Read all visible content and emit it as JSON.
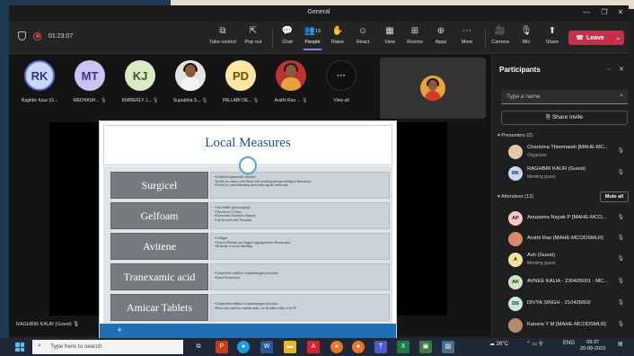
{
  "window": {
    "title": "General"
  },
  "toolbar": {
    "timer": "01:23:07",
    "buttons": [
      {
        "label": "Take control",
        "icon": "⧉"
      },
      {
        "label": "Pop out",
        "icon": "⇱"
      },
      {
        "label": "Chat",
        "icon": "💬"
      },
      {
        "label": "People",
        "icon": "👥"
      },
      {
        "label": "Raise",
        "icon": "✋"
      },
      {
        "label": "React",
        "icon": "☺"
      },
      {
        "label": "View",
        "icon": "▦"
      },
      {
        "label": "Rooms",
        "icon": "⊞"
      },
      {
        "label": "Apps",
        "icon": "⊕"
      },
      {
        "label": "More",
        "icon": "⋯"
      },
      {
        "label": "Camera",
        "icon": "🎥"
      },
      {
        "label": "Mic",
        "icon": "🎙"
      },
      {
        "label": "Share",
        "icon": "⬆"
      }
    ],
    "people_count": "15",
    "leave_label": "Leave"
  },
  "gallery": [
    {
      "initials": "RK",
      "name": "Raghbir Kaur (G...",
      "color": "#c9d6f5",
      "text": "#2b3a7a"
    },
    {
      "initials": "MT",
      "name": "MEDHASH...",
      "color": "#cbc4f2",
      "text": "#3d2f8a"
    },
    {
      "initials": "KJ",
      "name": "KIMBERLY J...",
      "color": "#dcebc7",
      "text": "#3c5a1c"
    },
    {
      "initials": "",
      "name": "Suprabha S...",
      "color": "",
      "text": ""
    },
    {
      "initials": "PD",
      "name": "PALLABI DE...",
      "color": "#fbe7a3",
      "text": "#6b4e00"
    },
    {
      "initials": "",
      "name": "Arathi Rao ...",
      "color": "",
      "text": ""
    },
    {
      "initials": "···",
      "name": "View all",
      "color": "",
      "text": ""
    }
  ],
  "slide": {
    "title": "Local Measures",
    "rows": [
      {
        "label": "Surgicel",
        "lines": [
          "•Oxidized regenerated cellulose",
          "•Swells on contact with blood with resulting pressure adding to hemostasis",
          "•Useful to control bleeding when other agents ineffective"
        ]
      },
      {
        "label": "Gelfoam",
        "lines": [
          "•Absorbable gelatin sponge",
          "•Absorbs in 3-5 days",
          "•Extractions/ Extensive Surgery",
          "•Can be used with Thrombin"
        ]
      },
      {
        "label": "Avitene",
        "lines": [
          "•Collagen",
          "•Attracts Platelets and triggers aggregation in fibrous mass",
          "•Moderate to severe bleeding"
        ]
      },
      {
        "label": "Tranexamic acid",
        "lines": [
          "•Competitive inhibitor of plasminogen activation",
          "•Dental Extractions"
        ]
      },
      {
        "label": "Amicar  Tablets",
        "lines": [
          "•Competitive inhibitor of plasminogen activation",
          "•Most often used as a mouth wash, can be taken orally or by IV"
        ]
      }
    ]
  },
  "presenter_tag": "RAGHBIR KAUR (Guest)",
  "participants": {
    "title": "Participants",
    "search_placeholder": "Type a name",
    "share_invite": "Share invite",
    "presenters_label": "Presenters (2)",
    "attendees_label": "Attendees (13)",
    "mute_all": "Mute all",
    "presenters": [
      {
        "initials": "",
        "name": "Charisma Thimmaiah [MAHE-MC...",
        "sub": "Organizer",
        "color": "#e6c9a8"
      },
      {
        "initials": "RK",
        "name": "RAGHBIR KAUR (Guest)",
        "sub": "Meeting guest",
        "color": "#c9d6f5"
      }
    ],
    "attendees": [
      {
        "initials": "AP",
        "name": "Anupama Nayak P [MAHE-MCO...",
        "sub": "",
        "color": "#f6c9c9"
      },
      {
        "initials": "",
        "name": "Arathi Rao [MAHE-MCODSMLR]",
        "sub": "",
        "color": "#d88a6b"
      },
      {
        "initials": "A",
        "name": "Ash (Guest)",
        "sub": "Meeting guest",
        "color": "#f3e3a0"
      },
      {
        "initials": "AK",
        "name": "AVNEE KALIA - 230426001 - MC...",
        "sub": "",
        "color": "#cfe6c5"
      },
      {
        "initials": "DS",
        "name": "DIVYA SINGH - 210426002",
        "sub": "",
        "color": "#c8ead9"
      },
      {
        "initials": "",
        "name": "Karuna Y M [MAHE-MCODSMLR]",
        "sub": "",
        "color": "#b98b6e"
      }
    ]
  },
  "taskbar": {
    "search_placeholder": "Type here to search",
    "temperature": "26°C",
    "lang": "ENG",
    "time": "09:37",
    "date": "20-09-2023"
  }
}
